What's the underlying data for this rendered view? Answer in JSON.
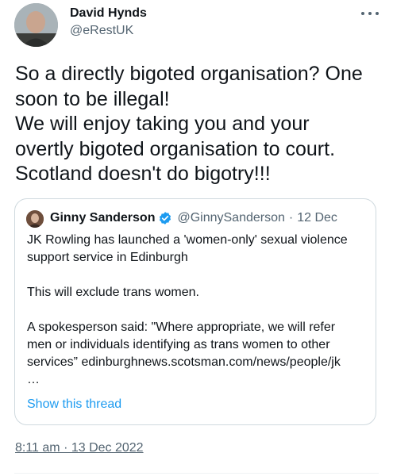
{
  "author": {
    "name": "David Hynds",
    "handle": "@eRestUK"
  },
  "tweet": {
    "lines": [
      "So a directly bigoted organisation? One",
      "soon to be illegal!",
      "We will enjoy taking you and your",
      "overtly bigoted organisation to court.",
      "Scotland doesn't do bigotry!!!"
    ],
    "timestamp": "8:11 am · 13 Dec 2022"
  },
  "quoted": {
    "name": "Ginny Sanderson",
    "handle": "@GinnySanderson",
    "separator": "·",
    "date": "12 Dec",
    "body": {
      "p1": [
        "JK Rowling has launched a 'women-only' sexual violence",
        "support service in Edinburgh"
      ],
      "p2": [
        "This will exclude trans women."
      ],
      "p3": [
        "A spokesperson said: \"Where appropriate, we will refer",
        "men or individuals identifying as trans women to other",
        "services” edinburghnews.scotsman.com/news/people/jk",
        "…"
      ]
    },
    "show_thread": "Show this thread"
  },
  "icons": {
    "more": "more-horizontal-icon",
    "verified": "verified-badge-icon"
  },
  "colors": {
    "link": "#1d9bf0",
    "secondary_text": "#536471",
    "border": "#cfd9de"
  }
}
